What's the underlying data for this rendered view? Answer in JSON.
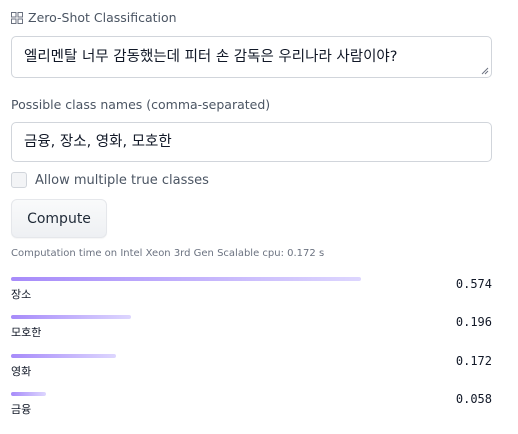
{
  "app": {
    "title": "Zero-Shot Classification"
  },
  "input_text": {
    "value": "엘리멘탈 너무 감동했는데 피터 손 감독은 우리나라 사람이야?"
  },
  "class_names": {
    "label": "Possible class names (comma-separated)",
    "value": "금융, 장소, 영화, 모호한"
  },
  "multi_class": {
    "label": "Allow multiple true classes",
    "checked": false
  },
  "compute_button": {
    "label": "Compute"
  },
  "timing": {
    "text": "Computation time on Intel Xeon 3rd Gen Scalable cpu: 0.172 s"
  },
  "colors": {
    "bar_start": "#a78bfa",
    "bar_end": "#ddd6fe"
  },
  "results": [
    {
      "label": "장소",
      "score": "0.574",
      "fraction": 0.574
    },
    {
      "label": "모호한",
      "score": "0.196",
      "fraction": 0.196
    },
    {
      "label": "영화",
      "score": "0.172",
      "fraction": 0.172
    },
    {
      "label": "금융",
      "score": "0.058",
      "fraction": 0.058
    }
  ]
}
